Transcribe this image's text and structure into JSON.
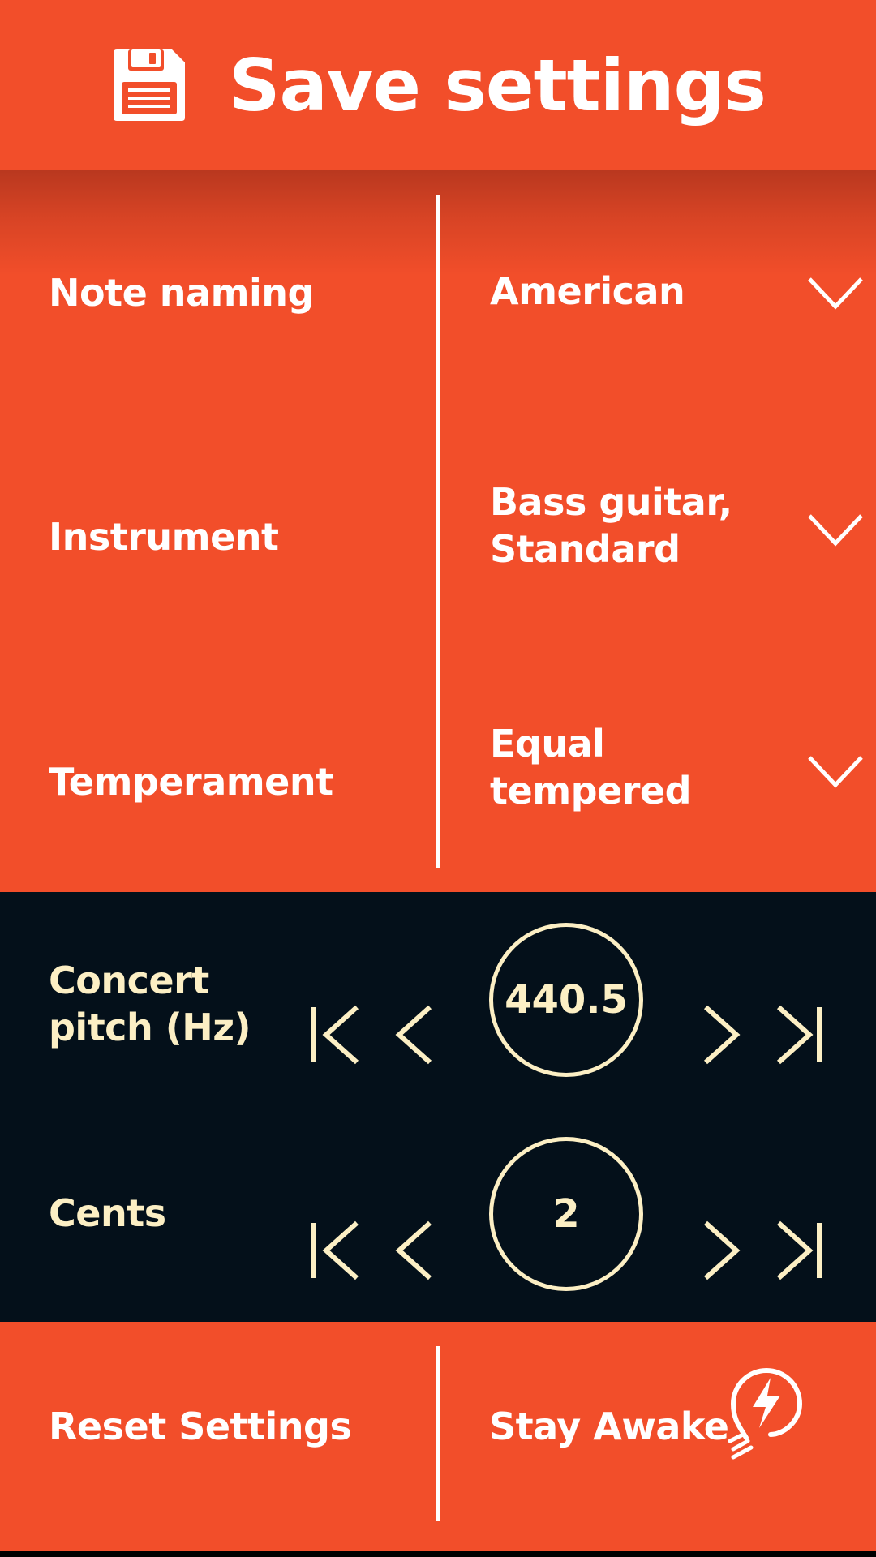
{
  "header": {
    "title": "Save settings",
    "icon": "floppy-disk-icon"
  },
  "settings": [
    {
      "label": "Note naming",
      "value": "American",
      "icon": "chevron-down-icon"
    },
    {
      "label": "Instrument",
      "value": "Bass guitar, Standard",
      "icon": "chevron-down-icon"
    },
    {
      "label": "Temperament",
      "value": "Equal tempered",
      "icon": "chevron-down-icon"
    }
  ],
  "pitch": {
    "concert_label": "Concert pitch (Hz)",
    "concert_value": "440.5",
    "cents_label": "Cents",
    "cents_value": "2",
    "icons": {
      "first": "skip-to-first-icon",
      "prev": "chevron-left-icon",
      "next": "chevron-right-icon",
      "last": "skip-to-last-icon"
    }
  },
  "bottom": {
    "reset_label": "Reset Settings",
    "stay_awake_label": "Stay Awake",
    "stay_awake_icon": "lightbulb-bolt-icon"
  },
  "colors": {
    "accent": "#F24E2A",
    "dark": "#04101A",
    "cream": "#FCEFC4",
    "white": "#FFFFFF"
  }
}
